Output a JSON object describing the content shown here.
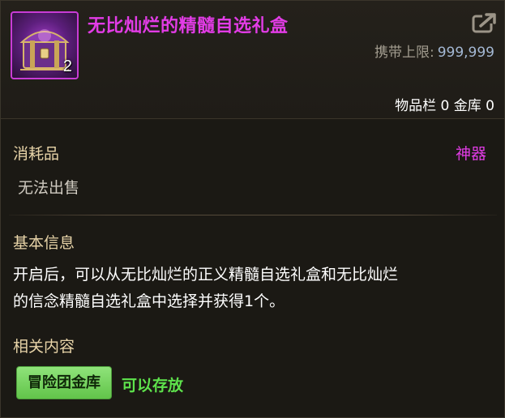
{
  "item": {
    "name": "无比灿烂的精髓自选礼盒",
    "stack_count": "2",
    "name_color": "#e23ce6",
    "icon": "purple-treasure-chest-icon"
  },
  "header": {
    "carry_limit_label": "携带上限:",
    "carry_limit_value": "999,999",
    "inventory_label": "物品栏",
    "inventory_count": "0",
    "vault_label": "金库",
    "vault_count": "0"
  },
  "category": {
    "type": "消耗品",
    "grade": "神器",
    "grade_color": "#e23ce6",
    "sell_status": "无法出售"
  },
  "basic_info": {
    "title": "基本信息",
    "description_line1": "开启后，可以从无比灿烂的正义精髓自选礼盒和无比灿烂",
    "description_line2": "的信念精髓自选礼盒中选择并获得1个。"
  },
  "related": {
    "title": "相关内容",
    "button_label": "冒险团金库",
    "button_color": "#7dd665",
    "status_text": "可以存放",
    "status_color": "#5ee34c"
  },
  "icons": {
    "share": "share-link-icon"
  }
}
